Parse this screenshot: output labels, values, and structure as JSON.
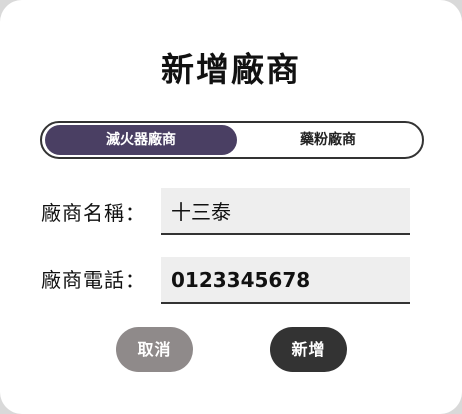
{
  "dialog": {
    "title": "新增廠商"
  },
  "vendor_type_toggle": {
    "options": [
      "滅火器廠商",
      "藥粉廠商"
    ],
    "selected": "滅火器廠商"
  },
  "form": {
    "name_label": "廠商名稱：",
    "name_value": "十三泰",
    "phone_label": "廠商電話：",
    "phone_value": "0123345678"
  },
  "actions": {
    "cancel_label": "取消",
    "add_label": "新增"
  },
  "colors": {
    "active_toggle": "#4a3f63",
    "cancel_button": "#8f8a8a",
    "add_button": "#333333",
    "field_background": "#eeeeee"
  }
}
